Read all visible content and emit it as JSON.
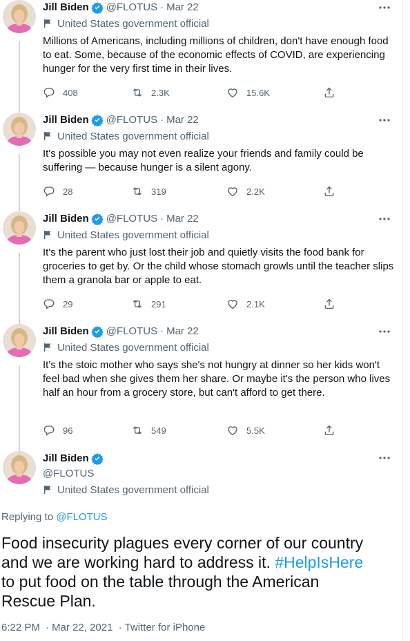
{
  "colors": {
    "accent": "#1d9bf0",
    "text": "#0f1419",
    "muted": "#536471",
    "thread": "#cfd9de"
  },
  "author": {
    "name": "Jill Biden",
    "handle": "@FLOTUS",
    "label": "United States government official",
    "avatar_icon": "profile-photo"
  },
  "tweets": [
    {
      "date": "Mar 22",
      "text": "Millions of Americans, including millions of children, don't have enough food to eat.  Some, because of the economic effects of COVID, are experiencing hunger for the very first time in their lives.",
      "replies": "408",
      "retweets": "2.3K",
      "likes": "15.6K"
    },
    {
      "date": "Mar 22",
      "text": "It's possible you may not even realize your friends and family could be suffering — because hunger is a silent agony.",
      "replies": "28",
      "retweets": "319",
      "likes": "2.2K"
    },
    {
      "date": "Mar 22",
      "text": "It's the parent who just lost their job and quietly visits the food bank for groceries to get by. Or the child whose stomach growls until the teacher slips them a granola bar or apple to eat.",
      "replies": "29",
      "retweets": "291",
      "likes": "2.1K"
    },
    {
      "date": "Mar 22",
      "text": "It's the stoic mother who says she's not hungry at dinner so her kids won't feel bad when she gives them her share. Or maybe it's the person who lives half an hour from a grocery store, but can't afford to get there.",
      "replies": "96",
      "retweets": "549",
      "likes": "5.5K"
    }
  ],
  "main_tweet": {
    "replying_to_label": "Replying to",
    "replying_to_handle": "@FLOTUS",
    "text_before": "Food insecurity plagues every corner of our country and we are working hard to address it. ",
    "hashtag": "#HelpIsHere",
    "text_after": " to put food on the table through the American Rescue Plan.",
    "time": "6:22 PM",
    "date": "Mar 22, 2021",
    "source": "Twitter for iPhone"
  }
}
